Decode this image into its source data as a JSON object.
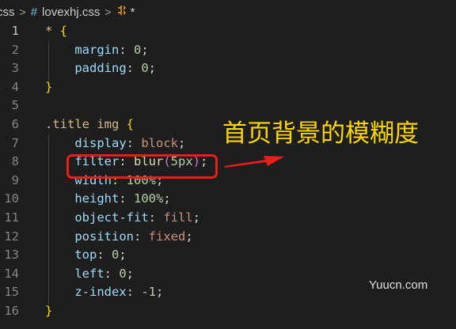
{
  "breadcrumb": {
    "folder": "css",
    "hash": "#",
    "file": "lovexhj.css",
    "symbol_icon": "selector-icon",
    "symbol": "*"
  },
  "lines": [
    {
      "n": "1",
      "active": true,
      "tokens": [
        {
          "t": "* ",
          "c": "sel"
        },
        {
          "t": "{",
          "c": "brace"
        }
      ]
    },
    {
      "n": "2",
      "tokens": [
        {
          "t": "    "
        },
        {
          "t": "margin",
          "c": "prop"
        },
        {
          "t": ": ",
          "c": "punc"
        },
        {
          "t": "0",
          "c": "num"
        },
        {
          "t": ";",
          "c": "punc"
        }
      ]
    },
    {
      "n": "3",
      "tokens": [
        {
          "t": "    "
        },
        {
          "t": "padding",
          "c": "prop"
        },
        {
          "t": ": ",
          "c": "punc"
        },
        {
          "t": "0",
          "c": "num"
        },
        {
          "t": ";",
          "c": "punc"
        }
      ]
    },
    {
      "n": "4",
      "tokens": [
        {
          "t": "}",
          "c": "brace"
        }
      ]
    },
    {
      "n": "5",
      "tokens": []
    },
    {
      "n": "6",
      "tokens": [
        {
          "t": ".title img ",
          "c": "sel"
        },
        {
          "t": "{",
          "c": "brace"
        }
      ]
    },
    {
      "n": "7",
      "tokens": [
        {
          "t": "    "
        },
        {
          "t": "display",
          "c": "prop"
        },
        {
          "t": ": ",
          "c": "punc"
        },
        {
          "t": "block",
          "c": "val"
        },
        {
          "t": ";",
          "c": "punc"
        }
      ]
    },
    {
      "n": "8",
      "tokens": [
        {
          "t": "    "
        },
        {
          "t": "filter",
          "c": "prop"
        },
        {
          "t": ": ",
          "c": "punc"
        },
        {
          "t": "blur",
          "c": "fn"
        },
        {
          "t": "(",
          "c": "paren"
        },
        {
          "t": "5px",
          "c": "num"
        },
        {
          "t": ")",
          "c": "paren"
        },
        {
          "t": ";",
          "c": "punc"
        }
      ]
    },
    {
      "n": "9",
      "tokens": [
        {
          "t": "    "
        },
        {
          "t": "width",
          "c": "prop"
        },
        {
          "t": ": ",
          "c": "punc"
        },
        {
          "t": "100%",
          "c": "num"
        },
        {
          "t": ";",
          "c": "punc"
        }
      ]
    },
    {
      "n": "10",
      "tokens": [
        {
          "t": "    "
        },
        {
          "t": "height",
          "c": "prop"
        },
        {
          "t": ": ",
          "c": "punc"
        },
        {
          "t": "100%",
          "c": "num"
        },
        {
          "t": ";",
          "c": "punc"
        }
      ]
    },
    {
      "n": "11",
      "tokens": [
        {
          "t": "    "
        },
        {
          "t": "object-fit",
          "c": "prop"
        },
        {
          "t": ": ",
          "c": "punc"
        },
        {
          "t": "fill",
          "c": "val"
        },
        {
          "t": ";",
          "c": "punc"
        }
      ]
    },
    {
      "n": "12",
      "tokens": [
        {
          "t": "    "
        },
        {
          "t": "position",
          "c": "prop"
        },
        {
          "t": ": ",
          "c": "punc"
        },
        {
          "t": "fixed",
          "c": "val"
        },
        {
          "t": ";",
          "c": "punc"
        }
      ]
    },
    {
      "n": "13",
      "tokens": [
        {
          "t": "    "
        },
        {
          "t": "top",
          "c": "prop"
        },
        {
          "t": ": ",
          "c": "punc"
        },
        {
          "t": "0",
          "c": "num"
        },
        {
          "t": ";",
          "c": "punc"
        }
      ]
    },
    {
      "n": "14",
      "tokens": [
        {
          "t": "    "
        },
        {
          "t": "left",
          "c": "prop"
        },
        {
          "t": ": ",
          "c": "punc"
        },
        {
          "t": "0",
          "c": "num"
        },
        {
          "t": ";",
          "c": "punc"
        }
      ]
    },
    {
      "n": "15",
      "tokens": [
        {
          "t": "    "
        },
        {
          "t": "z-index",
          "c": "prop"
        },
        {
          "t": ": ",
          "c": "punc"
        },
        {
          "t": "-1",
          "c": "num"
        },
        {
          "t": ";",
          "c": "punc"
        }
      ]
    },
    {
      "n": "16",
      "tokens": [
        {
          "t": "}",
          "c": "brace"
        }
      ]
    }
  ],
  "annotation": {
    "text": "首页背景的模糊度",
    "color": "#ffd700",
    "marker_color": "#e81e1e"
  },
  "watermark": "Yuucn.com",
  "colors": {
    "background": "#1e1e1e",
    "selector": "#d7ba7d",
    "property": "#9cdcfe",
    "number": "#b5cea8",
    "keyword_value": "#ce9178",
    "function": "#dcdcaa",
    "brace": "#ffd700"
  }
}
